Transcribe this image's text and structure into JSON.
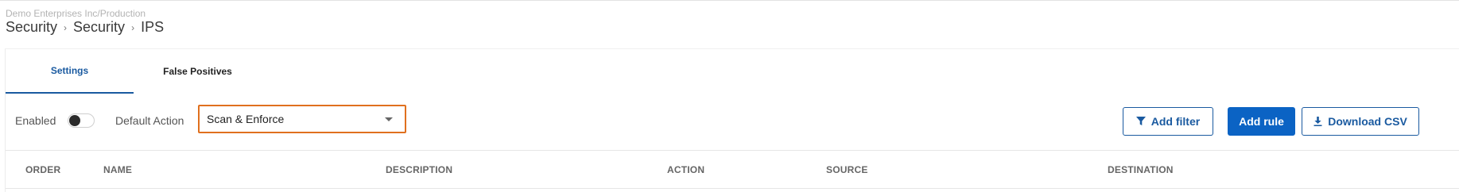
{
  "header": {
    "org_path": "Demo Enterprises Inc/Production",
    "breadcrumb": [
      "Security",
      "Security",
      "IPS"
    ]
  },
  "tabs": [
    {
      "label": "Settings",
      "active": true
    },
    {
      "label": "False Positives",
      "active": false
    }
  ],
  "toolbar": {
    "enabled_label": "Enabled",
    "enabled": false,
    "default_action_label": "Default Action",
    "default_action_value": "Scan & Enforce",
    "add_filter_label": "Add filter",
    "add_rule_label": "Add rule",
    "download_csv_label": "Download CSV"
  },
  "table": {
    "columns": [
      "ORDER",
      "NAME",
      "DESCRIPTION",
      "ACTION",
      "SOURCE",
      "DESTINATION"
    ]
  },
  "colors": {
    "accent": "#1a5aa0",
    "primary_button": "#0b63c4",
    "select_highlight": "#e0701e"
  }
}
